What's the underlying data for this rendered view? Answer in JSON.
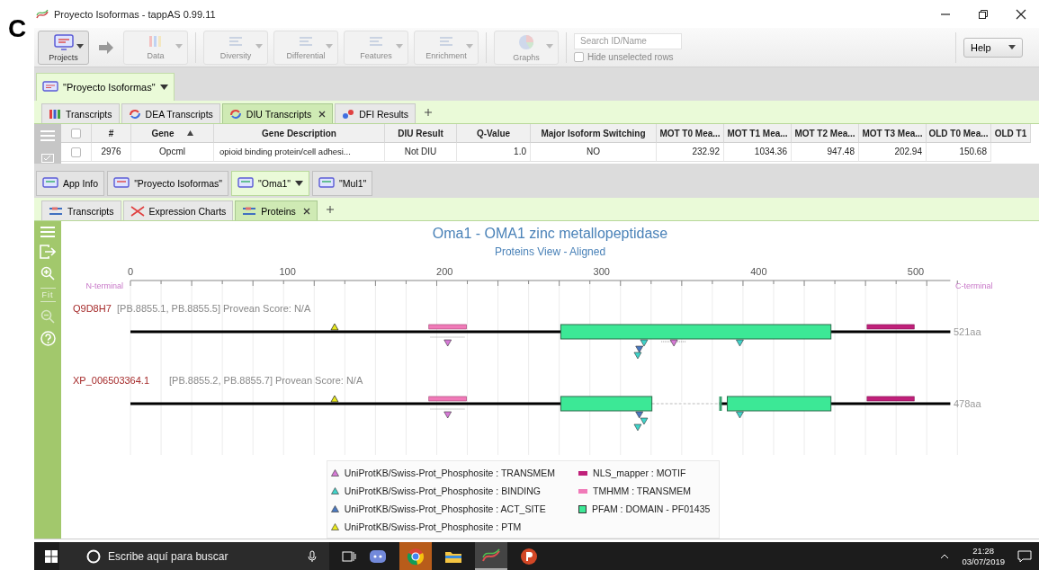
{
  "figure_label": "C",
  "window": {
    "title": "Proyecto Isoformas - tappAS 0.99.11"
  },
  "toolbar": {
    "buttons": [
      {
        "label": "Projects",
        "disabled": false
      },
      {
        "label": "Data",
        "disabled": true
      },
      {
        "label": "Diversity",
        "disabled": true
      },
      {
        "label": "Differential",
        "disabled": true
      },
      {
        "label": "Features",
        "disabled": true
      },
      {
        "label": "Enrichment",
        "disabled": true
      },
      {
        "label": "Graphs",
        "disabled": true
      }
    ],
    "search": {
      "placeholder": "Search ID/Name"
    },
    "hide_unselected": {
      "label": "Hide unselected rows",
      "checked": false
    },
    "help": "Help"
  },
  "project_tab": {
    "label": "\"Proyecto Isoformas\""
  },
  "data_tabs": [
    {
      "label": "Transcripts",
      "selected": false,
      "closable": false
    },
    {
      "label": "DEA Transcripts",
      "selected": false,
      "closable": false
    },
    {
      "label": "DIU Transcripts",
      "selected": true,
      "closable": true
    },
    {
      "label": "DFI Results",
      "selected": false,
      "closable": false
    }
  ],
  "table": {
    "select_all_checked": false,
    "columns": [
      {
        "label": "#",
        "sorted": false
      },
      {
        "label": "Gene",
        "sorted": true
      },
      {
        "label": "Gene Description",
        "sorted": false
      },
      {
        "label": "DIU Result",
        "sorted": false
      },
      {
        "label": "Q-Value",
        "sorted": false
      },
      {
        "label": "Major Isoform Switching",
        "sorted": false
      },
      {
        "label": "MOT T0 Mea...",
        "sorted": false
      },
      {
        "label": "MOT T1 Mea...",
        "sorted": false
      },
      {
        "label": "MOT T2 Mea...",
        "sorted": false
      },
      {
        "label": "MOT T3 Mea...",
        "sorted": false
      },
      {
        "label": "OLD T0 Mea...",
        "sorted": false
      },
      {
        "label": "OLD T1",
        "sorted": false
      }
    ],
    "rows": [
      {
        "checked": false,
        "cells": [
          "2976",
          "Opcml",
          "opioid binding protein/cell adhesi...",
          "Not DIU",
          "1.0",
          "NO",
          "232.92",
          "1034.36",
          "947.48",
          "202.94",
          "150.68"
        ]
      }
    ]
  },
  "view_tabs": [
    {
      "label": "App Info",
      "selected": false,
      "menu": false
    },
    {
      "label": "\"Proyecto Isoformas\"",
      "selected": false,
      "menu": false
    },
    {
      "label": "\"Oma1\"",
      "selected": true,
      "menu": true
    },
    {
      "label": "\"Mul1\"",
      "selected": false,
      "menu": false
    }
  ],
  "sub_tabs": [
    {
      "label": "Transcripts",
      "selected": false,
      "closable": false
    },
    {
      "label": "Expression Charts",
      "selected": false,
      "closable": false
    },
    {
      "label": "Proteins",
      "selected": true,
      "closable": true
    }
  ],
  "side_tools": {
    "fit_label": "Fit"
  },
  "protein_view": {
    "title": "Oma1 - OMA1 zinc metallopeptidase",
    "subtitle": "Proteins View - Aligned",
    "axis_ticks": [
      "0",
      "100",
      "200",
      "300",
      "400",
      "500"
    ],
    "n_label": "N-terminal",
    "c_label": "C-terminal",
    "proteins": [
      {
        "id": "Q9D8H7",
        "info": "[PB.8855.1, PB.8855.5] Provean Score: N/A",
        "length": "521aa"
      },
      {
        "id": "XP_006503364.1",
        "info": "[PB.8855.2, PB.8855.7] Provean Score: N/A",
        "length": "478aa"
      }
    ],
    "legend": [
      {
        "label": "UniProtKB/Swiss-Prot_Phosphosite : TRANSMEM",
        "kind": "triangle",
        "color": "#d77ad7"
      },
      {
        "label": "UniProtKB/Swiss-Prot_Phosphosite : BINDING",
        "kind": "triangle",
        "color": "#3fd3c9"
      },
      {
        "label": "UniProtKB/Swiss-Prot_Phosphosite : ACT_SITE",
        "kind": "triangle",
        "color": "#4a78c0"
      },
      {
        "label": "UniProtKB/Swiss-Prot_Phosphosite : PTM",
        "kind": "triangle",
        "color": "#e8e81a"
      },
      {
        "label": "NLS_mapper : MOTIF",
        "kind": "bar",
        "color": "#c0207a"
      },
      {
        "label": "TMHMM : TRANSMEM",
        "kind": "bar",
        "color": "#f07ab8"
      },
      {
        "label": "PFAM : DOMAIN - PF01435",
        "kind": "square",
        "color": "#3ce896"
      }
    ]
  },
  "taskbar": {
    "search_placeholder": "Escribe aquí para buscar",
    "time": "21:28",
    "date": "03/07/2019"
  }
}
